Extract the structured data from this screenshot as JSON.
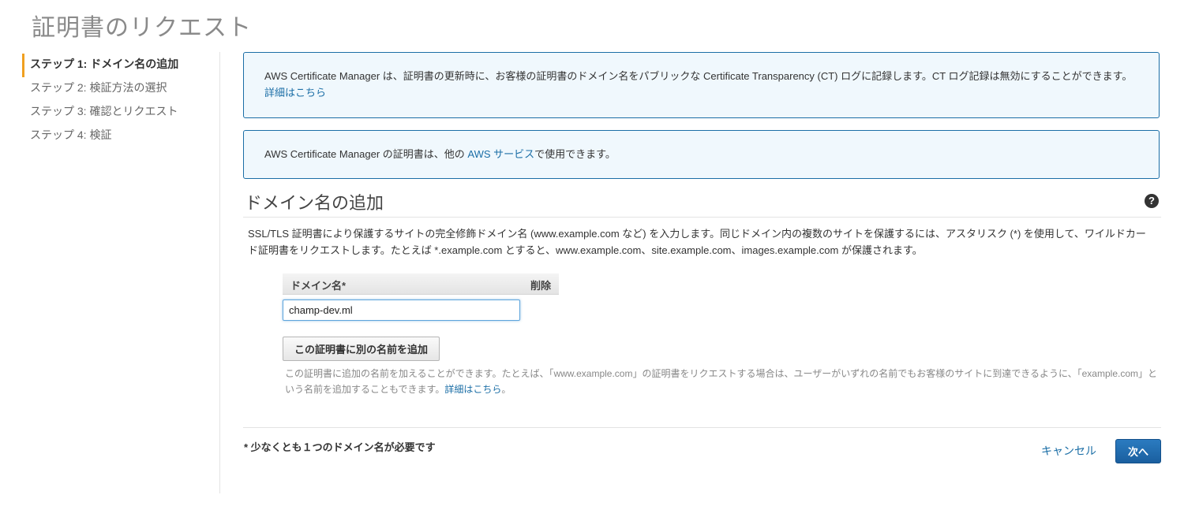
{
  "page": {
    "title": "証明書のリクエスト"
  },
  "steps": [
    {
      "label": "ステップ 1: ドメイン名の追加",
      "active": true
    },
    {
      "label": "ステップ 2: 検証方法の選択",
      "active": false
    },
    {
      "label": "ステップ 3: 確認とリクエスト",
      "active": false
    },
    {
      "label": "ステップ 4: 検証",
      "active": false
    }
  ],
  "info_box_1": {
    "text": "AWS Certificate Manager は、証明書の更新時に、お客様の証明書のドメイン名をパブリックな Certificate Transparency (CT) ログに記録します。CT ログ記録は無効にすることができます。",
    "link": "詳細はこちら"
  },
  "info_box_2": {
    "text_before": "AWS Certificate Manager の証明書は、他の ",
    "link": "AWS サービス",
    "text_after": "で使用できます。"
  },
  "section": {
    "title": "ドメイン名の追加",
    "description": "SSL/TLS 証明書により保護するサイトの完全修飾ドメイン名 (www.example.com など) を入力します。同じドメイン内の複数のサイトを保護するには、アスタリスク (*) を使用して、ワイルドカード証明書をリクエストします。たとえば *.example.com とすると、www.example.com、site.example.com、images.example.com が保護されます。"
  },
  "domain_table": {
    "col_name": "ドメイン名*",
    "col_delete": "削除",
    "value": "champ-dev.ml"
  },
  "add_name_button": "この証明書に別の名前を追加",
  "hint": {
    "text": "この証明書に追加の名前を加えることができます。たとえば、「www.example.com」の証明書をリクエストする場合は、ユーザーがいずれの名前でもお客様のサイトに到達できるように、「example.com」という名前を追加することもできます。",
    "link": "詳細はこちら",
    "after": "。"
  },
  "footer": {
    "required_note": "* 少なくとも１つのドメイン名が必要です",
    "cancel": "キャンセル",
    "next": "次へ"
  },
  "colors": {
    "accent": "#1b6ea6",
    "info_bg": "#f0f8fd",
    "active_step": "#f0a020"
  }
}
